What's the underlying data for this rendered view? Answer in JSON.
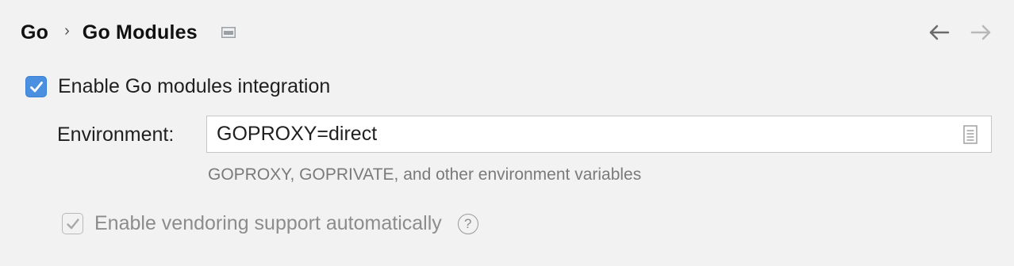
{
  "breadcrumb": {
    "items": [
      "Go",
      "Go Modules"
    ],
    "separator": "›"
  },
  "nav": {
    "back_icon": "arrow-left-icon",
    "forward_icon": "arrow-right-icon"
  },
  "enable_modules": {
    "label": "Enable Go modules integration",
    "checked": true
  },
  "environment": {
    "label": "Environment:",
    "value": "GOPROXY=direct",
    "hint": "GOPROXY, GOPRIVATE, and other environment variables",
    "browse_icon": "document-icon"
  },
  "vendoring": {
    "label": "Enable vendoring support automatically",
    "checked": true,
    "enabled": false,
    "help": "?"
  },
  "colors": {
    "accent": "#4b8fe0",
    "background": "#f2f2f2",
    "hint_text": "#7a7a7a",
    "disabled_text": "#8c8c8c"
  }
}
